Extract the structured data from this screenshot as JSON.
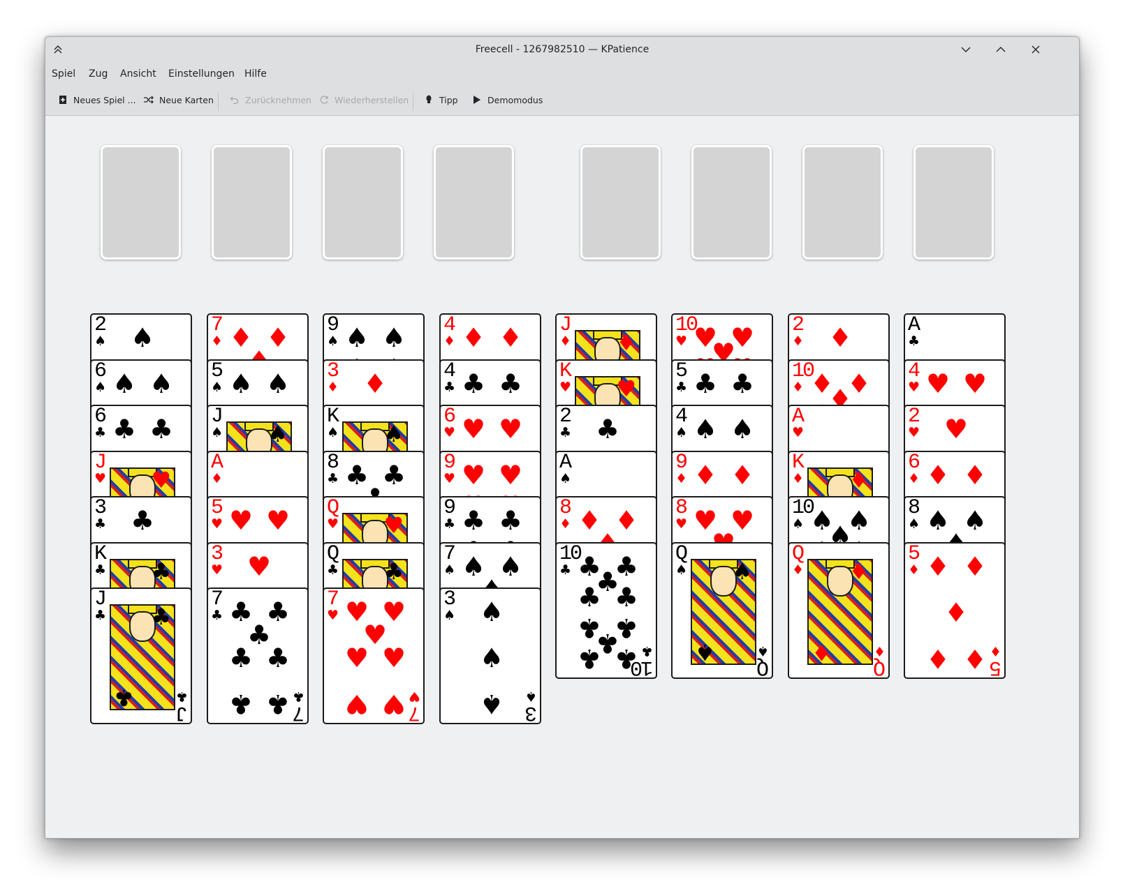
{
  "window": {
    "title": "Freecell - 1267982510 — KPatience"
  },
  "menu": [
    "Spiel",
    "Zug",
    "Ansicht",
    "Einstellungen",
    "Hilfe"
  ],
  "toolbar": {
    "new_game": "Neues Spiel ...",
    "new_cards": "Neue Karten",
    "undo": "Zurücknehmen",
    "redo": "Wiederherstellen",
    "hint": "Tipp",
    "demo": "Demomodus"
  },
  "icons": {
    "shade": "chevron-up-double-icon",
    "minimize": "chevron-down-icon",
    "maximize": "chevron-up-icon",
    "close": "close-icon",
    "new_game": "new-document-icon",
    "new_cards": "shuffle-icon",
    "undo": "undo-icon",
    "redo": "redo-icon",
    "hint": "lightbulb-icon",
    "demo": "play-icon"
  },
  "colors": {
    "red_suit": "#ff0000",
    "black_suit": "#000000",
    "slot": "#d4d4d4",
    "felt": "#eff0f1"
  },
  "free_cells": 4,
  "foundations": 4,
  "tableau": [
    [
      {
        "rank": "2",
        "suit": "♠"
      },
      {
        "rank": "6",
        "suit": "♠"
      },
      {
        "rank": "6",
        "suit": "♣"
      },
      {
        "rank": "J",
        "suit": "♥"
      },
      {
        "rank": "3",
        "suit": "♣"
      },
      {
        "rank": "K",
        "suit": "♣"
      },
      {
        "rank": "J",
        "suit": "♣"
      }
    ],
    [
      {
        "rank": "7",
        "suit": "♦"
      },
      {
        "rank": "5",
        "suit": "♠"
      },
      {
        "rank": "J",
        "suit": "♠"
      },
      {
        "rank": "A",
        "suit": "♦"
      },
      {
        "rank": "5",
        "suit": "♥"
      },
      {
        "rank": "3",
        "suit": "♥"
      },
      {
        "rank": "7",
        "suit": "♣"
      }
    ],
    [
      {
        "rank": "9",
        "suit": "♠"
      },
      {
        "rank": "3",
        "suit": "♦"
      },
      {
        "rank": "K",
        "suit": "♠"
      },
      {
        "rank": "8",
        "suit": "♣"
      },
      {
        "rank": "Q",
        "suit": "♥"
      },
      {
        "rank": "Q",
        "suit": "♣"
      },
      {
        "rank": "7",
        "suit": "♥"
      }
    ],
    [
      {
        "rank": "4",
        "suit": "♦"
      },
      {
        "rank": "4",
        "suit": "♣"
      },
      {
        "rank": "6",
        "suit": "♥"
      },
      {
        "rank": "9",
        "suit": "♥"
      },
      {
        "rank": "9",
        "suit": "♣"
      },
      {
        "rank": "7",
        "suit": "♠"
      },
      {
        "rank": "3",
        "suit": "♠"
      }
    ],
    [
      {
        "rank": "J",
        "suit": "♦"
      },
      {
        "rank": "K",
        "suit": "♥"
      },
      {
        "rank": "2",
        "suit": "♣"
      },
      {
        "rank": "A",
        "suit": "♠"
      },
      {
        "rank": "8",
        "suit": "♦"
      },
      {
        "rank": "10",
        "suit": "♣"
      }
    ],
    [
      {
        "rank": "10",
        "suit": "♥"
      },
      {
        "rank": "5",
        "suit": "♣"
      },
      {
        "rank": "4",
        "suit": "♠"
      },
      {
        "rank": "9",
        "suit": "♦"
      },
      {
        "rank": "8",
        "suit": "♥"
      },
      {
        "rank": "Q",
        "suit": "♠"
      }
    ],
    [
      {
        "rank": "2",
        "suit": "♦"
      },
      {
        "rank": "10",
        "suit": "♦"
      },
      {
        "rank": "A",
        "suit": "♥"
      },
      {
        "rank": "K",
        "suit": "♦"
      },
      {
        "rank": "10",
        "suit": "♠"
      },
      {
        "rank": "Q",
        "suit": "♦"
      }
    ],
    [
      {
        "rank": "A",
        "suit": "♣"
      },
      {
        "rank": "4",
        "suit": "♥"
      },
      {
        "rank": "2",
        "suit": "♥"
      },
      {
        "rank": "6",
        "suit": "♦"
      },
      {
        "rank": "8",
        "suit": "♠"
      },
      {
        "rank": "5",
        "suit": "♦"
      }
    ]
  ]
}
